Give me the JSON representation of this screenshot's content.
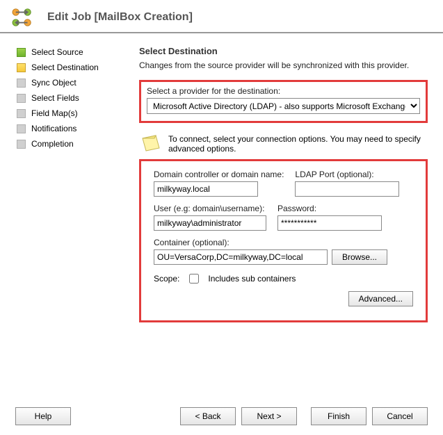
{
  "window": {
    "title": "Edit Job [MailBox Creation]"
  },
  "nav": {
    "items": [
      {
        "label": "Select Source",
        "state": "done"
      },
      {
        "label": "Select Destination",
        "state": "current"
      },
      {
        "label": "Sync Object",
        "state": "pending"
      },
      {
        "label": "Select Fields",
        "state": "pending"
      },
      {
        "label": "Field Map(s)",
        "state": "pending"
      },
      {
        "label": "Notifications",
        "state": "pending"
      },
      {
        "label": "Completion",
        "state": "pending"
      }
    ]
  },
  "main": {
    "heading": "Select Destination",
    "subtext": "Changes from the source provider will be synchronized with this provider.",
    "provider_label": "Select a provider for the destination:",
    "provider_value": "Microsoft Active Directory (LDAP) - also supports Microsoft Exchange",
    "conn_text": "To connect, select your connection options.  You may need to specify advanced options.",
    "domain_label": "Domain controller or domain name:",
    "domain_value": "milkyway.local",
    "ldap_label": "LDAP Port (optional):",
    "ldap_value": "",
    "user_label": "User (e.g: domain\\username):",
    "user_value": "milkyway\\administrator",
    "pass_label": "Password:",
    "pass_value": "***********",
    "container_label": "Container (optional):",
    "container_value": "OU=VersaCorp,DC=milkyway,DC=local",
    "browse_label": "Browse...",
    "scope_label": "Scope:",
    "sub_containers_label": "Includes sub containers",
    "advanced_label": "Advanced..."
  },
  "footer": {
    "help": "Help",
    "back": "< Back",
    "next": "Next >",
    "finish": "Finish",
    "cancel": "Cancel"
  }
}
